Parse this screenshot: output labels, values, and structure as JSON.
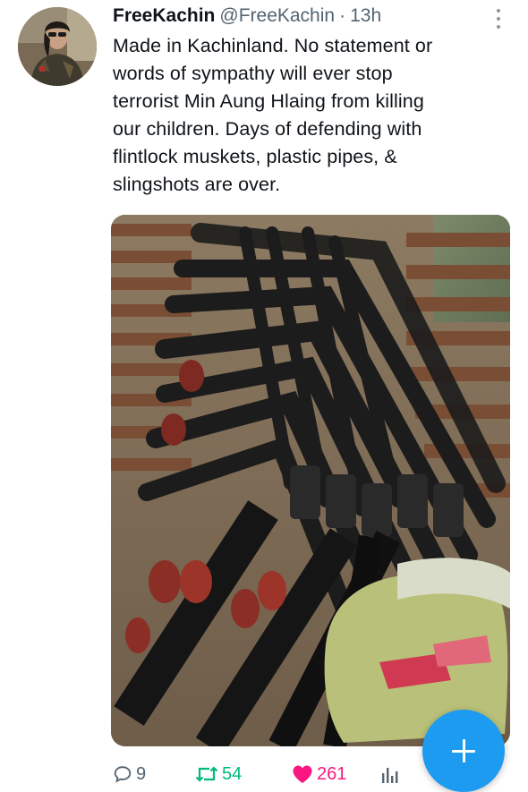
{
  "tweet": {
    "author": {
      "display_name": "FreeKachin",
      "handle": "@FreeKachin",
      "separator": "·",
      "time": "13h"
    },
    "text_lines": [
      "Made in Kachinland.  No statement or",
      "words of sympathy will ever stop",
      "terrorist Min Aung Hlaing from killing",
      "our children.  Days of defending with",
      "flintlock muskets, plastic pipes, &",
      "slingshots are over."
    ],
    "stats": {
      "replies": "9",
      "retweets": "54",
      "likes": "261"
    }
  },
  "icons": {
    "more": "more-vertical-icon",
    "reply": "reply-bubble-icon",
    "retweet": "retweet-icon",
    "like": "heart-icon",
    "views": "views-chart-icon",
    "fab": "plus-icon"
  },
  "colors": {
    "brand_blue": "#1d9bf0",
    "retweet_green": "#00ba7c",
    "like_pink": "#f91880",
    "muted_text": "#536471"
  }
}
